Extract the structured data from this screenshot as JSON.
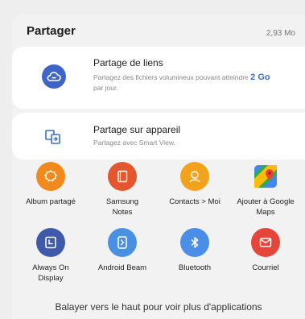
{
  "header": {
    "title": "Partager",
    "size": "2,93 Mo"
  },
  "link_share": {
    "title": "Partage de liens",
    "subtitle_before": "Partagez des fichiers volumineux pouvant atteindre",
    "subtitle_amount": "2 Go",
    "subtitle_after": "par jour.",
    "icon": "cloud-link-icon",
    "color": "#3f64c8"
  },
  "device_share": {
    "title": "Partage sur appareil",
    "subtitle": "Partagez avec Smart View.",
    "icon": "smart-view-icon",
    "color": "#3a70c9"
  },
  "apps": [
    {
      "label": "Album partagé",
      "icon": "shared-album-icon",
      "color": "#f08a1c"
    },
    {
      "label": "Samsung Notes",
      "icon": "samsung-notes-icon",
      "color": "#e4572e"
    },
    {
      "label": "Contacts > Moi",
      "icon": "contacts-icon",
      "color": "#f3a21b"
    },
    {
      "label": "Ajouter à Google Maps",
      "icon": "google-maps-icon",
      "color": "#34a853"
    },
    {
      "label": "Always On Display",
      "icon": "always-on-display-icon",
      "color": "#3f5aa8"
    },
    {
      "label": "Android Beam",
      "icon": "android-beam-icon",
      "color": "#4a90e2"
    },
    {
      "label": "Bluetooth",
      "icon": "bluetooth-icon",
      "color": "#4a8ee8"
    },
    {
      "label": "Courriel",
      "icon": "email-icon",
      "color": "#e5453b"
    }
  ],
  "footer": {
    "text": "Balayer vers le haut pour voir plus d'applications"
  }
}
